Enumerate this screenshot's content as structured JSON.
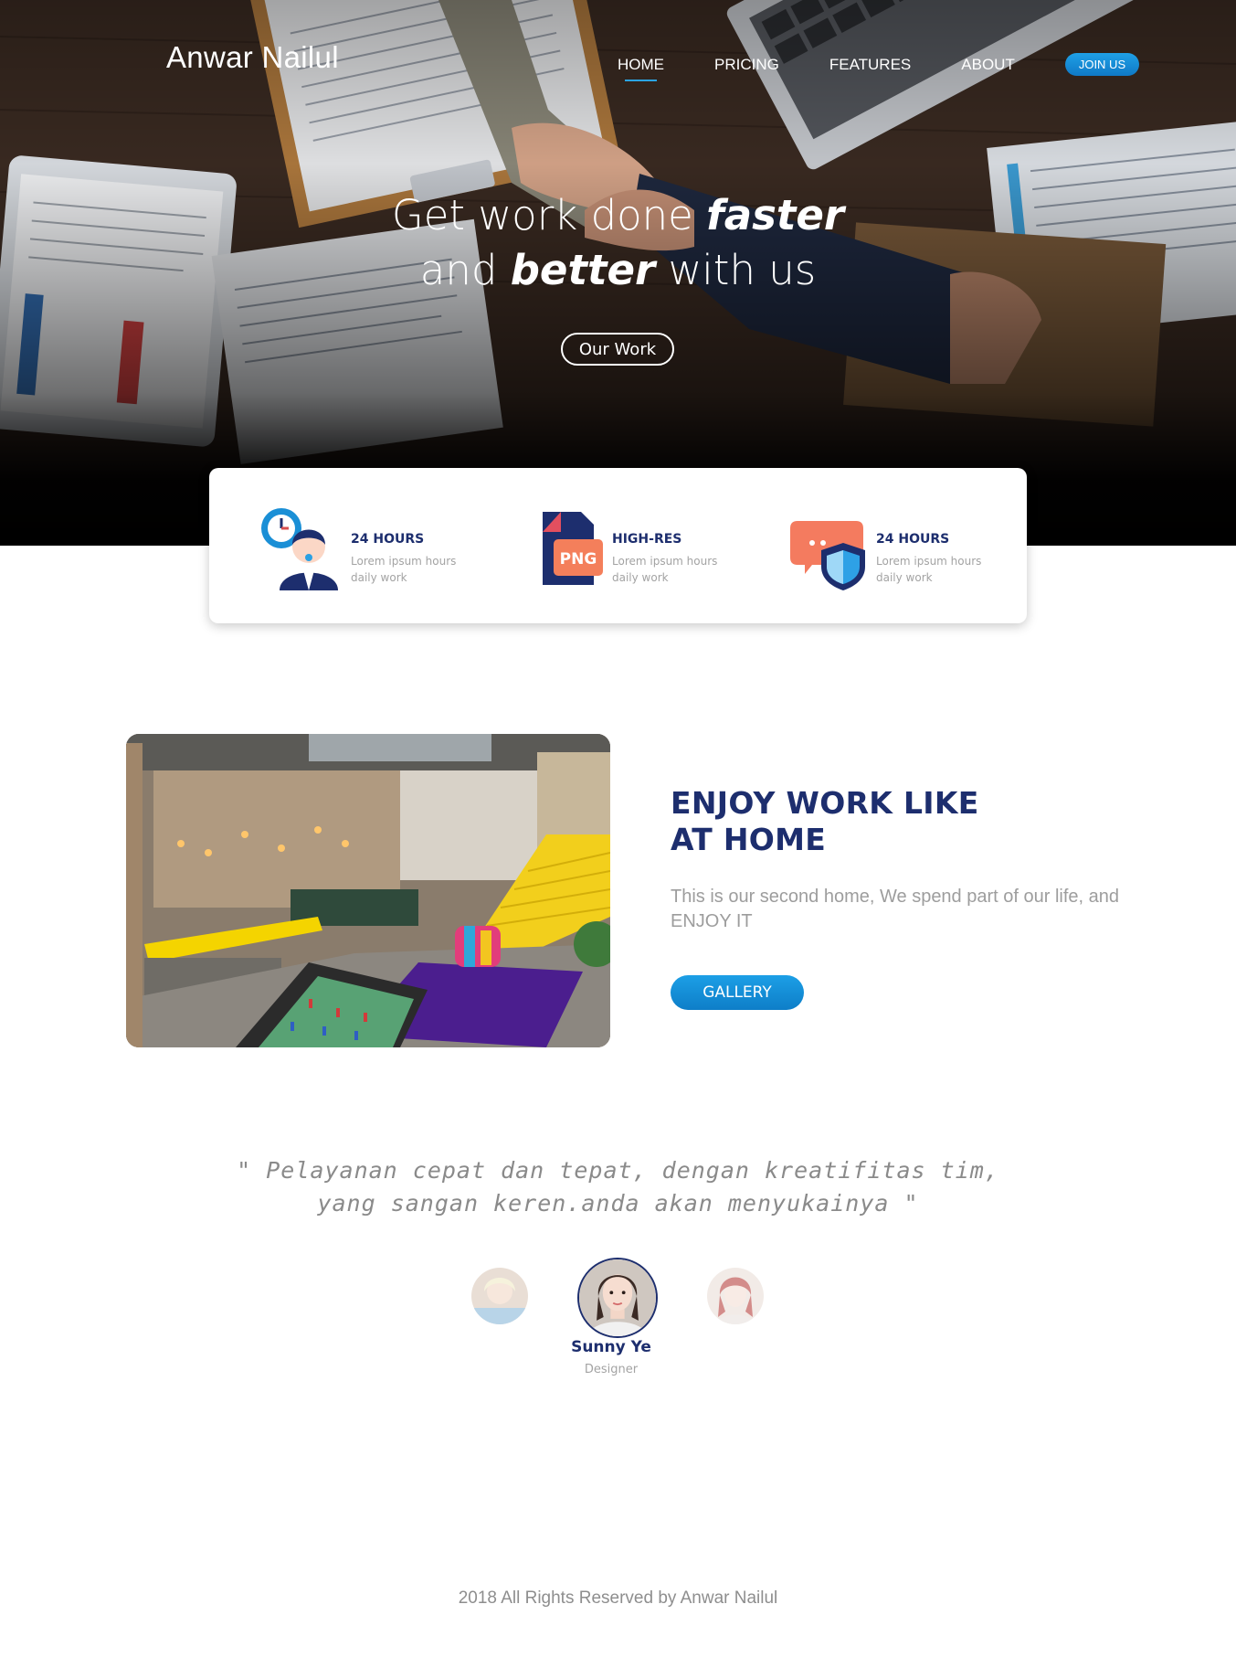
{
  "header": {
    "brand": "Anwar Nailul",
    "nav": [
      {
        "label": "HOME",
        "active": true
      },
      {
        "label": "PRICING",
        "active": false
      },
      {
        "label": "FEATURES",
        "active": false
      },
      {
        "label": "ABOUT",
        "active": false
      }
    ],
    "join_label": "JOIN US"
  },
  "hero": {
    "title_line1_prefix": "Get work done ",
    "title_line1_bold": "faster",
    "title_line2_prefix": "and ",
    "title_line2_bold": "better",
    "title_line2_suffix": " with us",
    "cta_label": "Our Work"
  },
  "features": [
    {
      "title": "24 HOURS",
      "desc": "Lorem ipsum hours daily work",
      "icon": "support-agent-clock-icon"
    },
    {
      "title": "HIGH-RES",
      "desc": "Lorem ipsum hours daily work",
      "icon": "png-file-icon",
      "icon_text": "PNG"
    },
    {
      "title": "24 HOURS",
      "desc": "Lorem ipsum hours daily work",
      "icon": "chat-shield-icon"
    }
  ],
  "enjoy": {
    "title_p1": "ENJOY ",
    "title_b1": "WORK",
    "title_p2": " LIKE",
    "title_p3": "AT ",
    "title_b2": "HOME",
    "text": "This is our second home, We spend part of our life, and ENJOY IT",
    "button_label": "GALLERY"
  },
  "testimonial": {
    "quote_line1": "\" Pelayanan cepat dan tepat, dengan kreatifitas tim,",
    "quote_line2": "yang sangan keren.anda akan menyukainya \"",
    "name": "Sunny Ye",
    "role": "Designer"
  },
  "footer": {
    "text": "2018 All Rights Reserved by Anwar Nailul"
  },
  "colors": {
    "accent": "#1a95dc",
    "navy": "#1d2e6e",
    "muted": "#9d9d9d"
  }
}
